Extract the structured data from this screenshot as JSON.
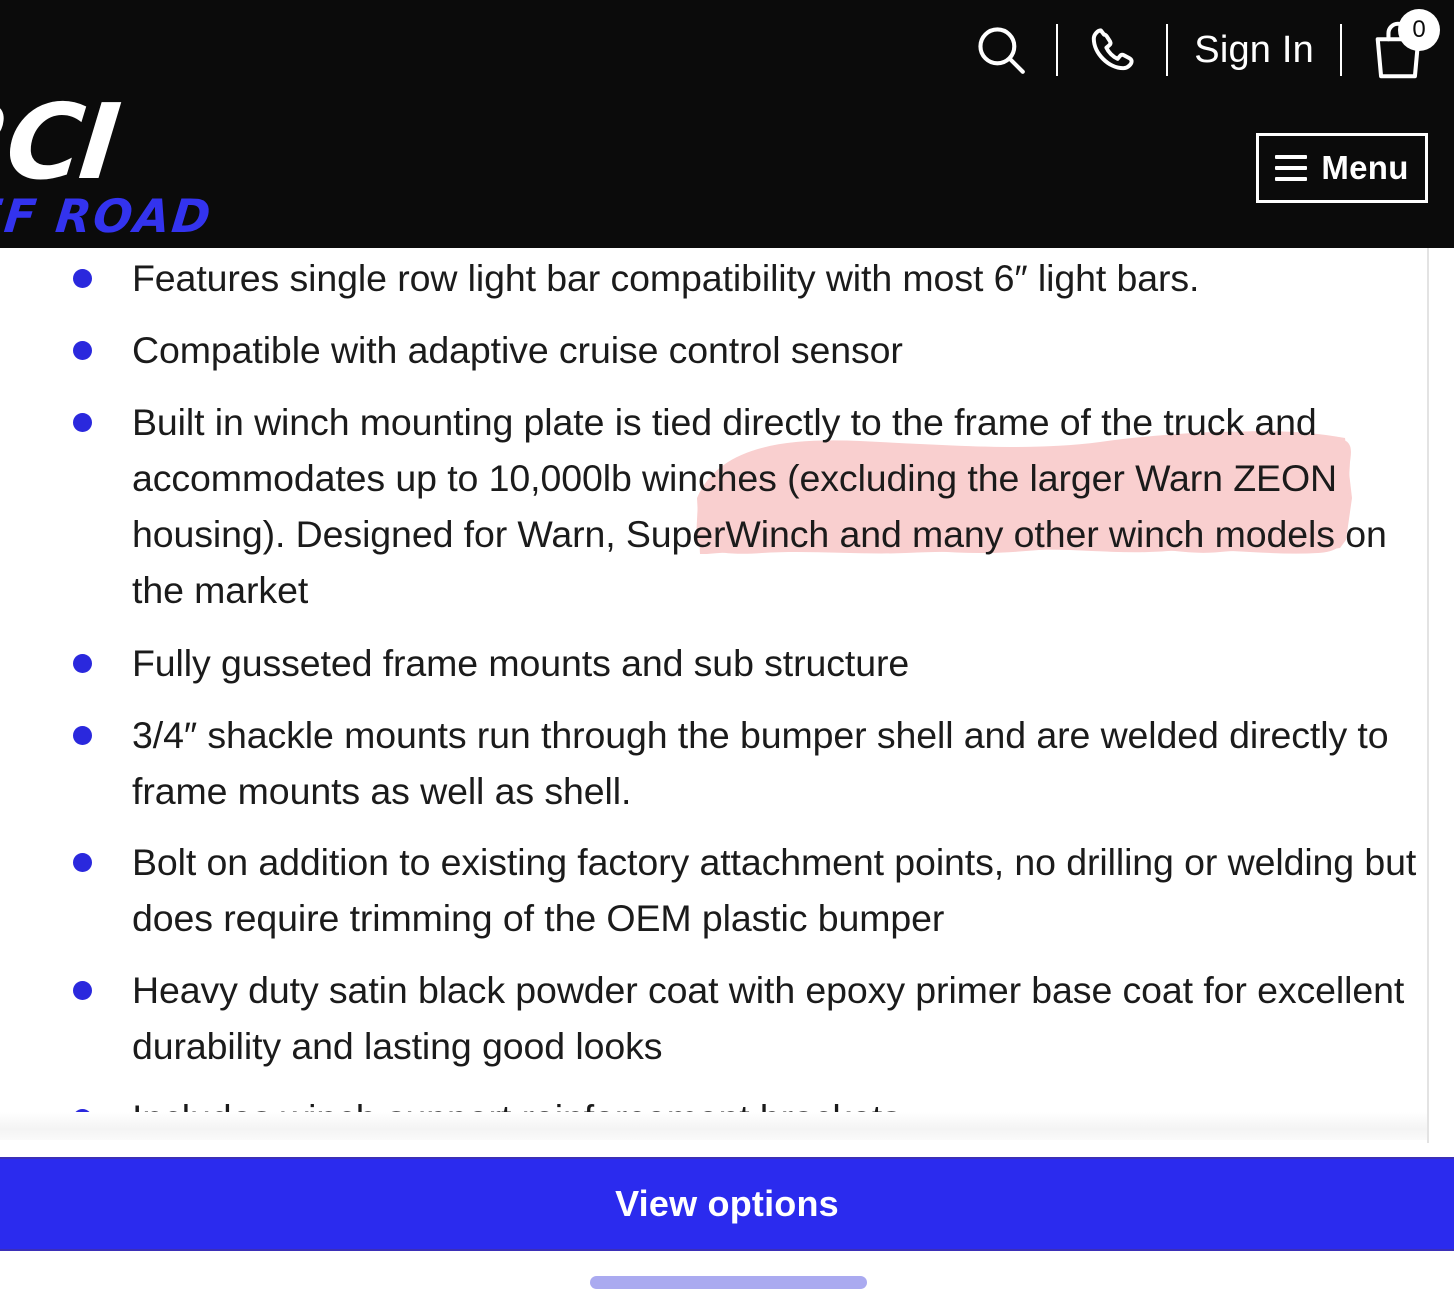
{
  "header": {
    "background_color": "#0b0b0b",
    "logo": {
      "main": "RCI",
      "sub": "OFF ROAD",
      "main_color": "#ffffff",
      "sub_color": "#3333ee"
    },
    "search_icon": "search-icon",
    "phone_icon": "phone-icon",
    "sign_in_label": "Sign In",
    "cart_icon": "shopping-bag-icon",
    "cart_count": "0",
    "menu_label": "Menu",
    "menu_icon": "hamburger-icon"
  },
  "main": {
    "bullets": [
      {
        "text": "Features single row light bar compatibility with most 6″ light bars."
      },
      {
        "text": "Compatible with adaptive cruise control sensor"
      },
      {
        "text": "Built in  winch mounting plate is tied directly to the frame of the truck and accommodates up to 10,000lb winches (excluding the larger Warn ZEON housing). Designed for Warn, SuperWinch and many other winch models on the market"
      },
      {
        "text": "Fully gusseted frame mounts and sub structure"
      },
      {
        "text": "3/4″ shackle mounts run through the bumper shell and are welded directly to frame mounts as well as shell."
      },
      {
        "text": "Bolt on addition to existing factory attachment points, no drilling or welding but does require trimming of the OEM plastic bumper"
      },
      {
        "text": "Heavy duty satin black powder coat with epoxy primer base coat for excellent durability and lasting good looks"
      },
      {
        "text": "Includes winch support reinforcement brackets"
      }
    ],
    "bullet_color": "#2a28dd",
    "text_color": "#1b1b1b",
    "annotation": {
      "type": "highlight",
      "color": "#f9cfcf",
      "covers_text": "(excluding the larger Warn ZEON housing). ... many other winch models on the market"
    }
  },
  "footer": {
    "view_options_label": "View options",
    "view_options_color": "#2b2bee",
    "home_indicator_color": "#aaaaf0"
  }
}
